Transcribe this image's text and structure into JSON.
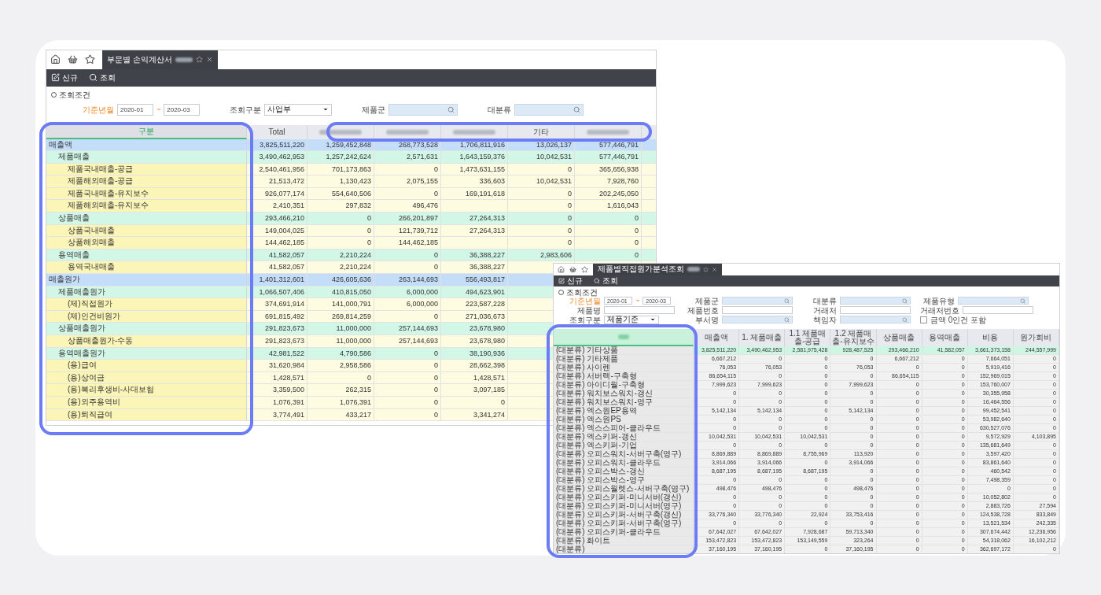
{
  "left_window": {
    "tab": {
      "title": "부문별 손익계산서",
      "redacted_suffix": true
    },
    "toolbar": [
      {
        "kind": "new",
        "label": "신규"
      },
      {
        "kind": "search",
        "label": "조회"
      }
    ],
    "filter": {
      "heading": "조회조건",
      "fields": [
        {
          "kind": "range",
          "label": "기준년월",
          "required": true,
          "from": "2020-01",
          "separator": "~",
          "to": "2020-03"
        },
        {
          "kind": "select",
          "label": "조회구분",
          "required": false,
          "value": "사업부"
        },
        {
          "kind": "search",
          "label": "제품군",
          "required": false
        },
        {
          "kind": "search",
          "label": "대분류",
          "required": false
        }
      ]
    },
    "table": {
      "columns": [
        {
          "label": "구분"
        },
        {
          "label": "Total"
        },
        {
          "redacted": true
        },
        {
          "redacted": true
        },
        {
          "redacted": true
        },
        {
          "label": "기타"
        },
        {
          "redacted": true
        }
      ],
      "rows": [
        {
          "label": "매출액",
          "total": "3,825,511,220",
          "column_2": "1,259,452,848",
          "column_3": "268,773,528",
          "column_4": "1,706,811,916",
          "other": "13,026,137",
          "column_6": "577,446,791",
          "children": [
            {
              "label": "제품매출",
              "total": "3,490,462,953",
              "column_2": "1,257,242,624",
              "column_3": "2,571,631",
              "column_4": "1,643,159,376",
              "other": "10,042,531",
              "column_6": "577,446,791",
              "children": [
                {
                  "label": "제품국내매출-공급",
                  "total": "2,540,461,956",
                  "column_2": "701,173,863",
                  "column_3": "0",
                  "column_4": "1,473,631,155",
                  "other": "0",
                  "column_6": "365,656,938"
                },
                {
                  "label": "제품해외매출-공급",
                  "total": "21,513,472",
                  "column_2": "1,130,423",
                  "column_3": "2,075,155",
                  "column_4": "336,603",
                  "other": "10,042,531",
                  "column_6": "7,928,760"
                },
                {
                  "label": "제품국내매출-유지보수",
                  "total": "926,077,174",
                  "column_2": "554,640,506",
                  "column_3": "0",
                  "column_4": "169,191,618",
                  "other": "0",
                  "column_6": "202,245,050"
                },
                {
                  "label": "제품해외매출-유지보수",
                  "total": "2,410,351",
                  "column_2": "297,832",
                  "column_3": "496,476",
                  "other": "0",
                  "column_6": "1,616,043"
                }
              ]
            },
            {
              "label": "상품매출",
              "total": "293,466,210",
              "column_2": "0",
              "column_3": "266,201,897",
              "column_4": "27,264,313",
              "other": "0",
              "column_6": "0",
              "children": [
                {
                  "label": "상품국내매출",
                  "total": "149,004,025",
                  "column_2": "0",
                  "column_3": "121,739,712",
                  "column_4": "27,264,313",
                  "other": "0",
                  "column_6": "0"
                },
                {
                  "label": "상품해외매출",
                  "total": "144,462,185",
                  "column_2": "0",
                  "column_3": "144,462,185",
                  "other": "0",
                  "column_6": "0"
                }
              ]
            },
            {
              "label": "용역매출",
              "total": "41,582,057",
              "column_2": "2,210,224",
              "column_3": "0",
              "column_4": "36,388,227",
              "other": "2,983,606",
              "column_6": "0",
              "children": [
                {
                  "label": "용역국내매출",
                  "total": "41,582,057",
                  "column_2": "2,210,224",
                  "column_3": "0",
                  "column_4": "36,388,227"
                }
              ]
            }
          ]
        },
        {
          "label": "매출원가",
          "total": "1,401,312,601",
          "column_2": "426,605,636",
          "column_3": "263,144,693",
          "column_4": "556,493,817",
          "children": [
            {
              "label": "제품매출원가",
              "total": "1,066,507,406",
              "column_2": "410,815,050",
              "column_3": "6,000,000",
              "column_4": "494,623,901",
              "children": [
                {
                  "label": "(제)직접원가",
                  "total": "374,691,914",
                  "column_2": "141,000,791",
                  "column_3": "6,000,000",
                  "column_4": "223,587,228"
                },
                {
                  "label": "(제)인건비원가",
                  "total": "691,815,492",
                  "column_2": "269,814,259",
                  "column_3": "0",
                  "column_4": "271,036,673"
                }
              ]
            },
            {
              "label": "상품매출원가",
              "total": "291,823,673",
              "column_2": "11,000,000",
              "column_3": "257,144,693",
              "column_4": "23,678,980",
              "children": [
                {
                  "label": "상품매출원가-수동",
                  "total": "291,823,673",
                  "column_2": "11,000,000",
                  "column_3": "257,144,693",
                  "column_4": "23,678,980"
                }
              ]
            },
            {
              "label": "용역매출원가",
              "total": "42,981,522",
              "column_2": "4,790,586",
              "column_3": "0",
              "column_4": "38,190,936",
              "children": [
                {
                  "label": "(용)급여",
                  "total": "31,620,984",
                  "column_2": "2,958,586",
                  "column_3": "0",
                  "column_4": "28,662,398"
                },
                {
                  "label": "(용)상여금",
                  "total": "1,428,571",
                  "column_2": "0",
                  "column_3": "0",
                  "column_4": "1,428,571"
                },
                {
                  "label": "(용)복리후생비-사대보험",
                  "total": "3,359,500",
                  "column_2": "262,315",
                  "column_3": "0",
                  "column_4": "3,097,185"
                },
                {
                  "label": "(용)외주용역비",
                  "total": "1,076,391",
                  "column_2": "1,076,391",
                  "column_3": "0",
                  "column_4": "0"
                },
                {
                  "label": "(용)퇴직급여",
                  "total": "3,774,491",
                  "column_2": "433,217",
                  "column_3": "0",
                  "column_4": "3,341,274"
                }
              ]
            }
          ]
        }
      ]
    }
  },
  "right_window": {
    "tab": {
      "title": "제품별직접원가분석조회",
      "redacted_suffix": true
    },
    "toolbar": [
      {
        "kind": "new",
        "label": "신규"
      },
      {
        "kind": "search",
        "label": "조회"
      }
    ],
    "filter": {
      "heading": "조회조건",
      "fields": [
        {
          "kind": "range",
          "label": "기준년월",
          "required": true,
          "from": "2020-01",
          "separator": "~",
          "to": "2020-03"
        },
        {
          "kind": "search",
          "label": "제품군",
          "required": false
        },
        {
          "kind": "search",
          "label": "대분류",
          "required": false
        },
        {
          "kind": "search",
          "label": "제품유형",
          "required": false
        },
        {
          "kind": "text",
          "label": "제품명",
          "required": false
        },
        {
          "kind": "text",
          "label": "제품번호",
          "required": false
        },
        {
          "kind": "text",
          "label": "거래처",
          "required": false
        },
        {
          "kind": "text",
          "label": "거래처번호",
          "required": false
        },
        {
          "kind": "select",
          "label": "조회구분",
          "required": false,
          "value": "제품기준"
        },
        {
          "kind": "search",
          "label": "부서명",
          "required": false
        },
        {
          "kind": "search",
          "label": "책임자",
          "required": false
        },
        {
          "kind": "checkbox",
          "label": "금액 0인건 포함",
          "checked": false
        }
      ]
    },
    "table": {
      "columns": [
        {
          "redacted": true
        },
        {
          "label": "매출액"
        },
        {
          "label": "1. 제품매출"
        },
        {
          "label": "1.1 제품매출-공급"
        },
        {
          "label": "1.2 제품매출-유지보수"
        },
        {
          "label": "상품매출"
        },
        {
          "label": "용역매출"
        },
        {
          "label": "비용"
        },
        {
          "label": "원가회비"
        }
      ],
      "rows": [
        {
          "kind": "total",
          "label": "(대분류) 기타상품",
          "values": [
            "3,825,511,220",
            "3,490,462,953",
            "2,581,975,428",
            "928,487,525",
            "293,466,210",
            "41,582,057",
            "3,661,373,158",
            "244,557,999"
          ]
        },
        {
          "kind": "item",
          "label": "(대분류) 기타제품",
          "values": [
            "6,667,212",
            "0",
            "0",
            "0",
            "6,667,212",
            "0",
            "7,664,051",
            "0"
          ]
        },
        {
          "kind": "item",
          "label": "(대분류) 사이렌",
          "values": [
            "76,053",
            "76,053",
            "0",
            "76,053",
            "0",
            "0",
            "5,919,416",
            "0"
          ]
        },
        {
          "kind": "item",
          "label": "(대분류) 서버랙-구축형",
          "values": [
            "86,654,115",
            "0",
            "0",
            "0",
            "86,654,115",
            "0",
            "152,969,015",
            "0"
          ]
        },
        {
          "kind": "item",
          "label": "(대분류) 아이디월-구축형",
          "values": [
            "7,999,623",
            "7,999,623",
            "0",
            "7,999,623",
            "0",
            "0",
            "153,760,007",
            "0"
          ]
        },
        {
          "kind": "item",
          "label": "(대분류) 워치보스워치-갱신",
          "values": [
            "0",
            "0",
            "0",
            "0",
            "0",
            "0",
            "30,355,958",
            "0"
          ]
        },
        {
          "kind": "item",
          "label": "(대분류) 워치보스워치-영구",
          "values": [
            "0",
            "0",
            "0",
            "0",
            "0",
            "0",
            "16,464,556",
            "0"
          ]
        },
        {
          "kind": "item",
          "label": "(대분류) 엑스원EP용역",
          "values": [
            "5,142,134",
            "5,142,134",
            "0",
            "5,142,134",
            "0",
            "0",
            "99,452,541",
            "0"
          ]
        },
        {
          "kind": "item",
          "label": "(대분류) 엑스원PS",
          "values": [
            "0",
            "0",
            "0",
            "0",
            "0",
            "0",
            "53,982,640",
            "0"
          ]
        },
        {
          "kind": "item",
          "label": "(대분류) 엑스스피어-클라우드",
          "values": [
            "0",
            "0",
            "0",
            "0",
            "0",
            "0",
            "630,527,076",
            "0"
          ]
        },
        {
          "kind": "item",
          "label": "(대분류) 엑스키퍼-갱신",
          "values": [
            "10,042,531",
            "10,042,531",
            "10,042,531",
            "0",
            "0",
            "0",
            "9,572,929",
            "4,103,895"
          ]
        },
        {
          "kind": "item",
          "label": "(대분류) 엑스키퍼-기업",
          "values": [
            "0",
            "0",
            "0",
            "0",
            "0",
            "0",
            "135,681,649",
            "0"
          ]
        },
        {
          "kind": "item",
          "label": "(대분류) 오피스워치-서버구축(영구)",
          "values": [
            "8,869,889",
            "8,869,889",
            "8,755,969",
            "113,920",
            "0",
            "0",
            "3,597,420",
            "0"
          ]
        },
        {
          "kind": "item",
          "label": "(대분류) 오피스워치-클라우드",
          "values": [
            "3,914,066",
            "3,914,066",
            "0",
            "3,914,066",
            "0",
            "0",
            "83,861,640",
            "0"
          ]
        },
        {
          "kind": "item",
          "label": "(대분류) 오피스박스-갱신",
          "values": [
            "8,687,195",
            "8,687,195",
            "8,687,195",
            "0",
            "0",
            "0",
            "460,542",
            "0"
          ]
        },
        {
          "kind": "item",
          "label": "(대분류) 오피스박스-영구",
          "values": [
            "0",
            "0",
            "0",
            "0",
            "0",
            "0",
            "7,498,359",
            "0"
          ]
        },
        {
          "kind": "item",
          "label": "(대분류) 오피스월렛스-서버구축(영구)",
          "values": [
            "498,476",
            "498,476",
            "0",
            "498,476",
            "0",
            "0",
            "0",
            "0"
          ]
        },
        {
          "kind": "item",
          "label": "(대분류) 오피스키퍼-미니서버(갱신)",
          "values": [
            "0",
            "0",
            "0",
            "0",
            "0",
            "0",
            "10,052,802",
            "0"
          ]
        },
        {
          "kind": "item",
          "label": "(대분류) 오피스키퍼-미니서버(영구)",
          "values": [
            "0",
            "0",
            "0",
            "0",
            "0",
            "0",
            "2,883,726",
            "27,594"
          ]
        },
        {
          "kind": "item",
          "label": "(대분류) 오피스키퍼-서버구축(갱신)",
          "values": [
            "33,776,340",
            "33,776,340",
            "22,924",
            "33,753,416",
            "0",
            "0",
            "124,538,728",
            "833,849"
          ]
        },
        {
          "kind": "item",
          "label": "(대분류) 오피스키퍼-서버구축(영구)",
          "values": [
            "0",
            "0",
            "0",
            "0",
            "0",
            "0",
            "13,521,534",
            "242,335"
          ]
        },
        {
          "kind": "item",
          "label": "(대분류) 오피스키퍼-클라우드",
          "values": [
            "67,642,027",
            "67,642,027",
            "7,928,687",
            "59,713,340",
            "0",
            "0",
            "307,674,442",
            "12,236,956"
          ]
        },
        {
          "kind": "item",
          "label": "(대분류) 화이트",
          "values": [
            "153,472,823",
            "153,472,823",
            "153,149,559",
            "323,264",
            "0",
            "0",
            "54,318,062",
            "16,102,212"
          ]
        },
        {
          "kind": "item",
          "label": "(대분류)",
          "values": [
            "37,160,195",
            "37,160,195",
            "0",
            "37,160,195",
            "0",
            "0",
            "362,697,172",
            "0"
          ]
        }
      ]
    }
  }
}
